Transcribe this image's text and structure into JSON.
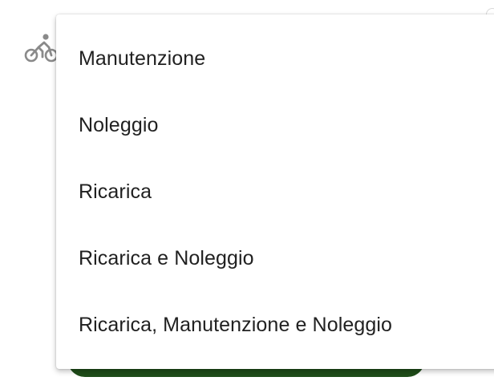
{
  "form": {
    "leading_icon": "bicycle-icon"
  },
  "dropdown": {
    "options": [
      "Manutenzione",
      "Noleggio",
      "Ricarica",
      "Ricarica e Noleggio",
      "Ricarica, Manutenzione e Noleggio"
    ]
  },
  "colors": {
    "button_green": "#1f4d19",
    "icon_gray": "#8a8a8a",
    "text": "#212121"
  }
}
